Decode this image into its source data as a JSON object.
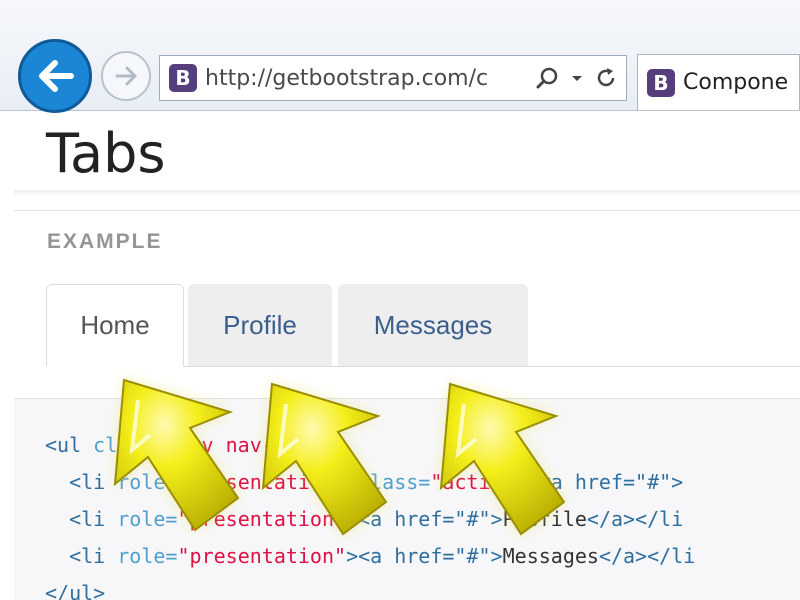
{
  "browser": {
    "url": "http://getbootstrap.com/c",
    "favicon_letter": "B",
    "tab_title": "Compone"
  },
  "page": {
    "title": "Tabs",
    "example_label": "EXAMPLE",
    "tabs": [
      {
        "label": "Home",
        "active": true
      },
      {
        "label": "Profile",
        "active": false
      },
      {
        "label": "Messages",
        "active": false
      }
    ]
  },
  "code": {
    "line1": {
      "open": "<ul ",
      "attr": "class=",
      "val": "\"nav nav-tabs\"",
      "close": ">"
    },
    "line2": {
      "indent": "  ",
      "open": "<li ",
      "attr1": "role=",
      "val1": "\"presentation\"",
      "attr2": " class=",
      "val2": "\"active\"",
      "close": "><a href=\"#\">"
    },
    "line3": {
      "indent": "  ",
      "open": "<li ",
      "attr": "role=",
      "val": "\"presentation\"",
      "mid": "><a href=\"#\">",
      "text": "Profile",
      "end": "</a></li"
    },
    "line4": {
      "indent": "  ",
      "open": "<li ",
      "attr": "role=",
      "val": "\"presentation\"",
      "mid": "><a href=\"#\">",
      "text": "Messages",
      "end": "</a></li"
    },
    "line5": {
      "close": "</ul>"
    }
  },
  "colors": {
    "back_button": "#1c86d6",
    "favicon": "#563d7c",
    "arrow": "#f4ef1c",
    "tab_text": "#3b5f8c"
  }
}
